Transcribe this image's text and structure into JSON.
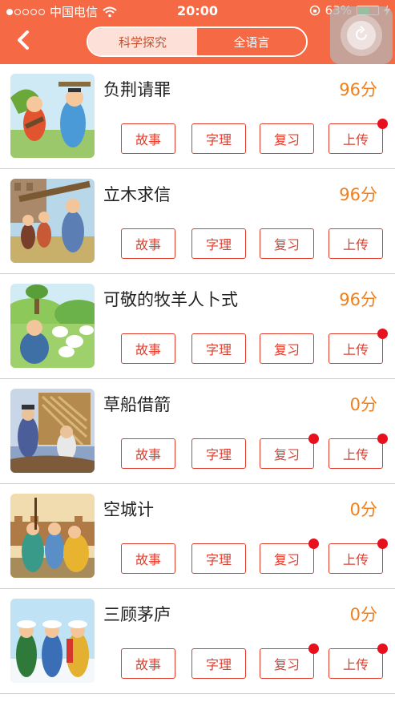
{
  "status_bar": {
    "carrier": "中国电信",
    "time": "20:00",
    "battery": "63%",
    "battery_level": 0.63
  },
  "tabs": [
    {
      "label": "科学探究",
      "active": false
    },
    {
      "label": "全语言",
      "active": true
    }
  ],
  "button_labels": {
    "story": "故事",
    "char": "字理",
    "review": "复习",
    "upload": "上传"
  },
  "items": [
    {
      "title": "负荆请罪",
      "score": "96分",
      "badges": {
        "story": false,
        "char": false,
        "review": false,
        "upload": true
      }
    },
    {
      "title": "立木求信",
      "score": "96分",
      "badges": {
        "story": false,
        "char": false,
        "review": false,
        "upload": false
      }
    },
    {
      "title": "可敬的牧羊人卜式",
      "score": "96分",
      "badges": {
        "story": false,
        "char": false,
        "review": false,
        "upload": true
      }
    },
    {
      "title": "草船借箭",
      "score": "0分",
      "badges": {
        "story": false,
        "char": false,
        "review": true,
        "upload": true
      }
    },
    {
      "title": "空城计",
      "score": "0分",
      "badges": {
        "story": false,
        "char": false,
        "review": true,
        "upload": true
      }
    },
    {
      "title": "三顾茅庐",
      "score": "0分",
      "badges": {
        "story": false,
        "char": false,
        "review": true,
        "upload": true
      }
    }
  ],
  "colors": {
    "header": "#f56a45",
    "score": "#f07f1e",
    "button_border": "#e03c2c",
    "badge": "#e8101c"
  }
}
